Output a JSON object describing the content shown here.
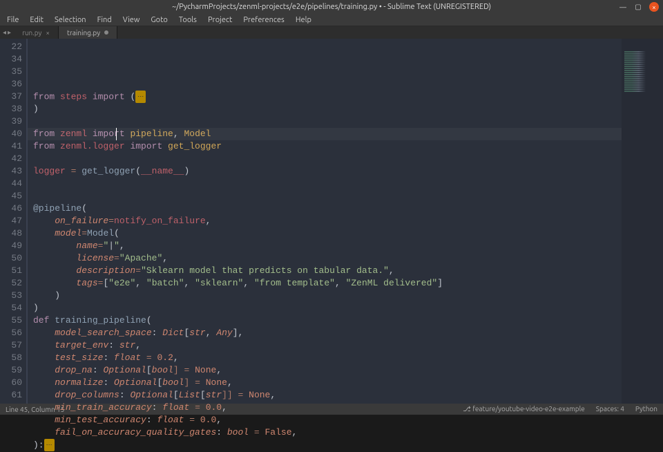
{
  "titlebar": {
    "title": "~/PycharmProjects/zenml-projects/e2e/pipelines/training.py • - Sublime Text (UNREGISTERED)"
  },
  "menu": {
    "items": [
      "File",
      "Edit",
      "Selection",
      "Find",
      "View",
      "Goto",
      "Tools",
      "Project",
      "Preferences",
      "Help"
    ]
  },
  "tabs": {
    "items": [
      {
        "label": "run.py",
        "active": false,
        "dirty": false
      },
      {
        "label": "training.py",
        "active": true,
        "dirty": true
      }
    ]
  },
  "editor": {
    "line_numbers": [
      22,
      34,
      35,
      36,
      37,
      38,
      39,
      40,
      41,
      42,
      43,
      44,
      45,
      46,
      47,
      48,
      49,
      50,
      51,
      52,
      53,
      54,
      55,
      56,
      57,
      58,
      59,
      60,
      61
    ],
    "lines": [
      [
        {
          "t": "from ",
          "c": "kw"
        },
        {
          "t": "steps ",
          "c": "name"
        },
        {
          "t": "import ",
          "c": "kw"
        },
        {
          "t": "(",
          "c": "punc"
        },
        {
          "t": "⋯",
          "c": "fold"
        }
      ],
      [
        {
          "t": ")",
          "c": "punc"
        }
      ],
      [],
      [
        {
          "t": "from ",
          "c": "kw"
        },
        {
          "t": "zenml ",
          "c": "name"
        },
        {
          "t": "import ",
          "c": "kw"
        },
        {
          "t": "pipeline",
          "c": "cls"
        },
        {
          "t": ", ",
          "c": "punc"
        },
        {
          "t": "Model",
          "c": "cls"
        }
      ],
      [
        {
          "t": "from ",
          "c": "kw"
        },
        {
          "t": "zenml.logger ",
          "c": "name"
        },
        {
          "t": "import ",
          "c": "kw"
        },
        {
          "t": "get_logger",
          "c": "cls"
        }
      ],
      [],
      [
        {
          "t": "logger ",
          "c": "name"
        },
        {
          "t": "= ",
          "c": "op"
        },
        {
          "t": "get_logger",
          "c": "fn"
        },
        {
          "t": "(",
          "c": "punc"
        },
        {
          "t": "__name__",
          "c": "name"
        },
        {
          "t": ")",
          "c": "punc"
        }
      ],
      [],
      [],
      [
        {
          "t": "@pipeline",
          "c": "decor"
        },
        {
          "t": "(",
          "c": "punc"
        }
      ],
      [
        {
          "t": "    ",
          "c": "punc"
        },
        {
          "t": "on_failure",
          "c": "param"
        },
        {
          "t": "=",
          "c": "op"
        },
        {
          "t": "notify_on_failure",
          "c": "name"
        },
        {
          "t": ",",
          "c": "punc"
        }
      ],
      [
        {
          "t": "    ",
          "c": "punc"
        },
        {
          "t": "model",
          "c": "param"
        },
        {
          "t": "=",
          "c": "op"
        },
        {
          "t": "Model",
          "c": "fn"
        },
        {
          "t": "(",
          "c": "punc"
        }
      ],
      [
        {
          "t": "        ",
          "c": "punc"
        },
        {
          "t": "name",
          "c": "param"
        },
        {
          "t": "=",
          "c": "op"
        },
        {
          "t": "\"",
          "c": "str"
        },
        {
          "t": "|",
          "c": "punc"
        },
        {
          "t": "\"",
          "c": "str"
        },
        {
          "t": ",",
          "c": "punc"
        }
      ],
      [
        {
          "t": "        ",
          "c": "punc"
        },
        {
          "t": "license",
          "c": "param"
        },
        {
          "t": "=",
          "c": "op"
        },
        {
          "t": "\"Apache\"",
          "c": "str"
        },
        {
          "t": ",",
          "c": "punc"
        }
      ],
      [
        {
          "t": "        ",
          "c": "punc"
        },
        {
          "t": "description",
          "c": "param"
        },
        {
          "t": "=",
          "c": "op"
        },
        {
          "t": "\"Sklearn model that predicts on tabular data.\"",
          "c": "str"
        },
        {
          "t": ",",
          "c": "punc"
        }
      ],
      [
        {
          "t": "        ",
          "c": "punc"
        },
        {
          "t": "tags",
          "c": "param"
        },
        {
          "t": "=",
          "c": "op"
        },
        {
          "t": "[",
          "c": "punc"
        },
        {
          "t": "\"e2e\"",
          "c": "str"
        },
        {
          "t": ", ",
          "c": "punc"
        },
        {
          "t": "\"batch\"",
          "c": "str"
        },
        {
          "t": ", ",
          "c": "punc"
        },
        {
          "t": "\"sklearn\"",
          "c": "str"
        },
        {
          "t": ", ",
          "c": "punc"
        },
        {
          "t": "\"from template\"",
          "c": "str"
        },
        {
          "t": ", ",
          "c": "punc"
        },
        {
          "t": "\"ZenML delivered\"",
          "c": "str"
        },
        {
          "t": "]",
          "c": "punc"
        }
      ],
      [
        {
          "t": "    )",
          "c": "punc"
        }
      ],
      [
        {
          "t": ")",
          "c": "punc"
        }
      ],
      [
        {
          "t": "def ",
          "c": "kw"
        },
        {
          "t": "training_pipeline",
          "c": "fn"
        },
        {
          "t": "(",
          "c": "punc"
        }
      ],
      [
        {
          "t": "    ",
          "c": "punc"
        },
        {
          "t": "model_search_space",
          "c": "param"
        },
        {
          "t": ": ",
          "c": "punc"
        },
        {
          "t": "Dict",
          "c": "type"
        },
        {
          "t": "[",
          "c": "punc"
        },
        {
          "t": "str",
          "c": "type"
        },
        {
          "t": ", ",
          "c": "punc"
        },
        {
          "t": "Any",
          "c": "type"
        },
        {
          "t": "],",
          "c": "punc"
        }
      ],
      [
        {
          "t": "    ",
          "c": "punc"
        },
        {
          "t": "target_env",
          "c": "param"
        },
        {
          "t": ": ",
          "c": "punc"
        },
        {
          "t": "str",
          "c": "type"
        },
        {
          "t": ",",
          "c": "punc"
        }
      ],
      [
        {
          "t": "    ",
          "c": "punc"
        },
        {
          "t": "test_size",
          "c": "param"
        },
        {
          "t": ": ",
          "c": "punc"
        },
        {
          "t": "float",
          "c": "type"
        },
        {
          "t": " = ",
          "c": "op"
        },
        {
          "t": "0.2",
          "c": "num"
        },
        {
          "t": ",",
          "c": "punc"
        }
      ],
      [
        {
          "t": "    ",
          "c": "punc"
        },
        {
          "t": "drop_na",
          "c": "param"
        },
        {
          "t": ": ",
          "c": "punc"
        },
        {
          "t": "Optional",
          "c": "type"
        },
        {
          "t": "[",
          "c": "punc"
        },
        {
          "t": "bool",
          "c": "type"
        },
        {
          "t": "] = ",
          "c": "op"
        },
        {
          "t": "None",
          "c": "const"
        },
        {
          "t": ",",
          "c": "punc"
        }
      ],
      [
        {
          "t": "    ",
          "c": "punc"
        },
        {
          "t": "normalize",
          "c": "param"
        },
        {
          "t": ": ",
          "c": "punc"
        },
        {
          "t": "Optional",
          "c": "type"
        },
        {
          "t": "[",
          "c": "punc"
        },
        {
          "t": "bool",
          "c": "type"
        },
        {
          "t": "] = ",
          "c": "op"
        },
        {
          "t": "None",
          "c": "const"
        },
        {
          "t": ",",
          "c": "punc"
        }
      ],
      [
        {
          "t": "    ",
          "c": "punc"
        },
        {
          "t": "drop_columns",
          "c": "param"
        },
        {
          "t": ": ",
          "c": "punc"
        },
        {
          "t": "Optional",
          "c": "type"
        },
        {
          "t": "[",
          "c": "punc"
        },
        {
          "t": "List",
          "c": "type"
        },
        {
          "t": "[",
          "c": "punc"
        },
        {
          "t": "str",
          "c": "type"
        },
        {
          "t": "]] = ",
          "c": "op"
        },
        {
          "t": "None",
          "c": "const"
        },
        {
          "t": ",",
          "c": "punc"
        }
      ],
      [
        {
          "t": "    ",
          "c": "punc"
        },
        {
          "t": "min_train_accuracy",
          "c": "param"
        },
        {
          "t": ": ",
          "c": "punc"
        },
        {
          "t": "float",
          "c": "type"
        },
        {
          "t": " = ",
          "c": "op"
        },
        {
          "t": "0.0",
          "c": "num"
        },
        {
          "t": ",",
          "c": "punc"
        }
      ],
      [
        {
          "t": "    ",
          "c": "punc"
        },
        {
          "t": "min_test_accuracy",
          "c": "param"
        },
        {
          "t": ": ",
          "c": "punc"
        },
        {
          "t": "float",
          "c": "type"
        },
        {
          "t": " = ",
          "c": "op"
        },
        {
          "t": "0.0",
          "c": "num"
        },
        {
          "t": ",",
          "c": "punc"
        }
      ],
      [
        {
          "t": "    ",
          "c": "punc"
        },
        {
          "t": "fail_on_accuracy_quality_gates",
          "c": "param"
        },
        {
          "t": ": ",
          "c": "punc"
        },
        {
          "t": "bool",
          "c": "type"
        },
        {
          "t": " = ",
          "c": "op"
        },
        {
          "t": "False",
          "c": "const"
        },
        {
          "t": ",",
          "c": "punc"
        }
      ],
      [
        {
          "t": "):",
          "c": "punc"
        },
        {
          "t": "⋯",
          "c": "fold"
        }
      ]
    ]
  },
  "statusbar": {
    "left": "Line 45, Column 15",
    "branch_icon": "⎇",
    "branch": "feature/youtube-video-e2e-example",
    "spaces": "Spaces: 4",
    "lang": "Python"
  }
}
